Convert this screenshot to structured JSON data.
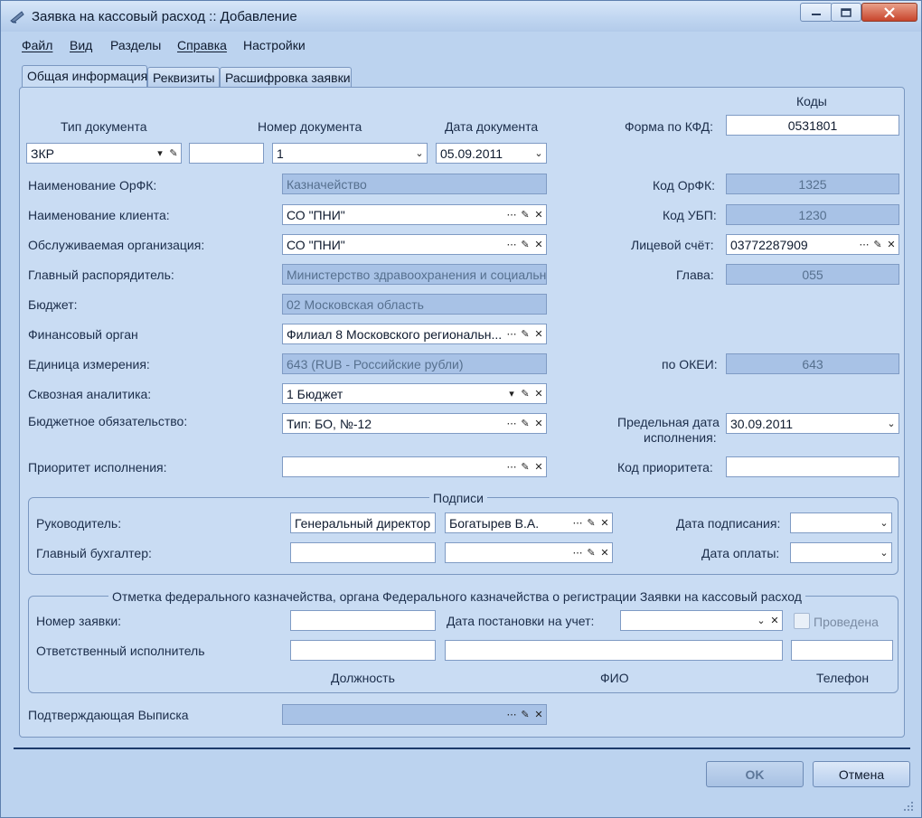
{
  "window": {
    "title": "Заявка на кассовый расход :: Добавление",
    "controls": {
      "minimize": "minimize-icon",
      "maximize": "maximize-icon",
      "close": "close-icon"
    }
  },
  "menu": {
    "file": "Файл",
    "view": "Вид",
    "sections": "Разделы",
    "help": "Справка",
    "settings": "Настройки"
  },
  "tabs": {
    "general": "Общая информация",
    "requisites": "Реквизиты",
    "decoding": "Расшифровка заявки"
  },
  "header": {
    "codes": "Коды",
    "doc_type_label": "Тип документа",
    "doc_number_label": "Номер документа",
    "doc_date_label": "Дата документа",
    "kfd_label": "Форма по КФД:",
    "doc_type": "ЗКР",
    "doc_series": "",
    "doc_number": "1",
    "doc_date": "05.09.2011",
    "kfd_code": "0531801"
  },
  "fields": {
    "orfk_name_label": "Наименование ОрФК:",
    "orfk_name": "Казначейство",
    "orfk_code_label": "Код ОрФК:",
    "orfk_code": "1325",
    "client_name_label": "Наименование клиента:",
    "client_name": "СО \"ПНИ\"",
    "ubp_code_label": "Код УБП:",
    "ubp_code": "1230",
    "served_org_label": "Обслуживаемая организация:",
    "served_org": "СО \"ПНИ\"",
    "account_label": "Лицевой счёт:",
    "account": "03772287909",
    "chief_manager_label": "Главный распорядитель:",
    "chief_manager": "Министерство здравоохранения и социальн",
    "chapter_label": "Глава:",
    "chapter": "055",
    "budget_label": "Бюджет:",
    "budget": "02 Московская область",
    "fin_body_label": "Финансовый орган",
    "fin_body": "Филиал 8 Московского региональн...",
    "unit_label": "Единица измерения:",
    "unit": "643 (RUB - Российские рубли)",
    "okei_label": "по ОКЕИ:",
    "okei": "643",
    "analytics_label": "Сквозная аналитика:",
    "analytics": "1 Бюджет",
    "obligation_label": "Бюджетное обязательство:",
    "obligation": "Тип: БО, №-12",
    "deadline_label_1": "Предельная дата",
    "deadline_label_2": "исполнения:",
    "deadline": "30.09.2011",
    "priority_label": "Приоритет исполнения:",
    "priority": "",
    "priority_code_label": "Код приоритета:",
    "priority_code": ""
  },
  "signatures": {
    "title": "Подписи",
    "head_label": "Руководитель:",
    "head_position": "Генеральный директор",
    "head_name": "Богатырев В.А.",
    "sign_date_label": "Дата подписания:",
    "sign_date": "",
    "accountant_label": "Главный бухгалтер:",
    "accountant_position": "",
    "accountant_name": "",
    "pay_date_label": "Дата оплаты:",
    "pay_date": ""
  },
  "treasury": {
    "title": "Отметка федерального казначейства, органа Федерального казначейства о регистрации Заявки на кассовый расход",
    "request_number_label": "Номер заявки:",
    "request_number": "",
    "reg_date_label": "Дата постановки на учет:",
    "reg_date": "",
    "posted_label": "Проведена",
    "executor_label": "Ответственный исполнитель",
    "executor_position": "",
    "executor_name": "",
    "executor_phone": "",
    "col_position": "Должность",
    "col_name": "ФИО",
    "col_phone": "Телефон"
  },
  "statement": {
    "label": "Подтверждающая Выписка",
    "value": ""
  },
  "buttons": {
    "ok": "OK",
    "cancel": "Отмена"
  }
}
